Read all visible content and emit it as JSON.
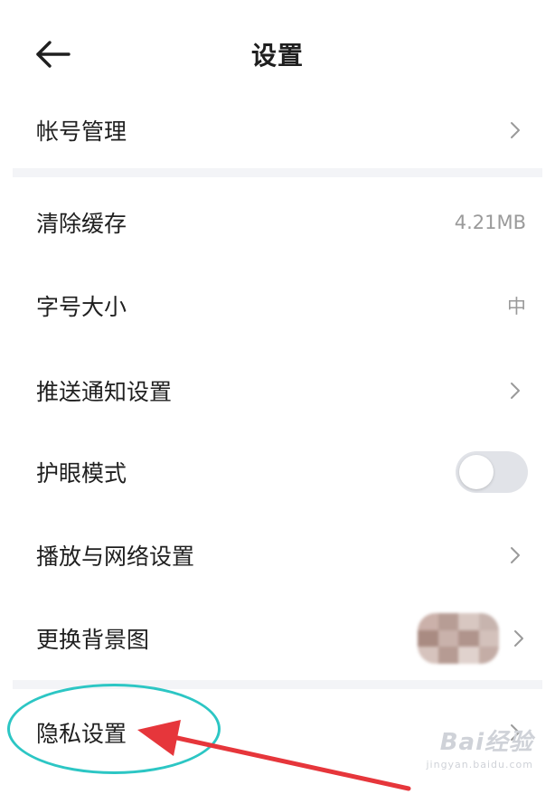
{
  "header": {
    "title": "设置",
    "back_icon": "arrow-left-icon"
  },
  "rows": [
    {
      "label": "帐号管理",
      "type": "link"
    },
    {
      "label": "清除缓存",
      "type": "value",
      "value": "4.21MB"
    },
    {
      "label": "字号大小",
      "type": "value",
      "value": "中"
    },
    {
      "label": "推送通知设置",
      "type": "link"
    },
    {
      "label": "护眼模式",
      "type": "toggle",
      "toggle_on": false
    },
    {
      "label": "播放与网络设置",
      "type": "link"
    },
    {
      "label": "更换背景图",
      "type": "link-thumbnail"
    },
    {
      "label": "隐私设置",
      "type": "link"
    }
  ],
  "annotations": {
    "highlight_color": "#2cc6c4",
    "arrow_color": "#e6363b"
  },
  "watermark": {
    "brand": "Bai经验",
    "sub": "jingyan.baidu.com"
  },
  "colors": {
    "text": "#1f1f1f",
    "secondary_text": "#9a9a9a",
    "chevron": "#9a9a9a",
    "toggle_off_track": "#e1e3e8"
  }
}
